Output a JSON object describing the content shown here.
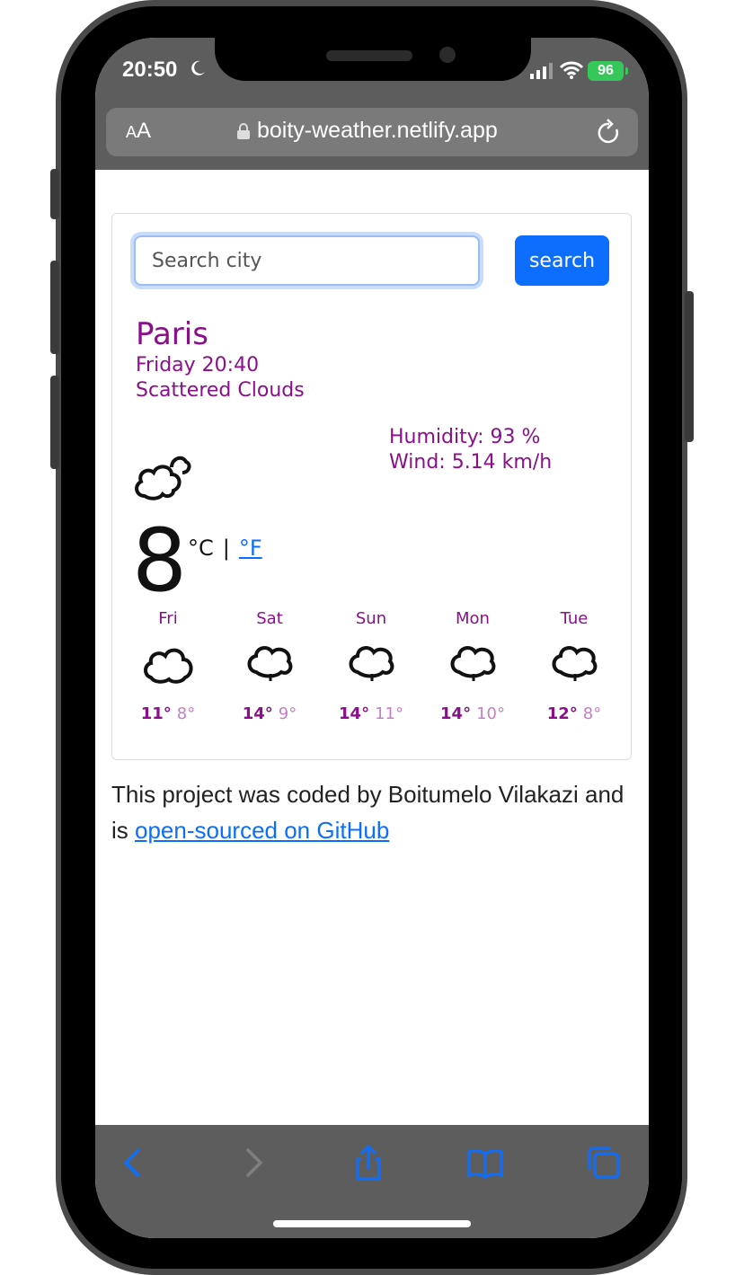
{
  "status_bar": {
    "time": "20:50",
    "battery": "96"
  },
  "browser": {
    "text_size_small": "A",
    "text_size_big": "A",
    "url": "boity-weather.netlify.app"
  },
  "search": {
    "placeholder": "Search city",
    "button_label": "search"
  },
  "weather": {
    "city": "Paris",
    "datetime": "Friday 20:40",
    "description": "Scattered Clouds",
    "humidity": "Humidity: 93 %",
    "wind": "Wind: 5.14 km/h",
    "temperature": "8",
    "unit_c": "°C",
    "unit_separator": "|",
    "unit_f": "°F",
    "icon": "scattered-clouds-icon"
  },
  "forecast": [
    {
      "day": "Fri",
      "max": "11°",
      "min": "8°",
      "icon": "cloud-icon"
    },
    {
      "day": "Sat",
      "max": "14°",
      "min": "9°",
      "icon": "cloud-icon"
    },
    {
      "day": "Sun",
      "max": "14°",
      "min": "11°",
      "icon": "cloud-icon"
    },
    {
      "day": "Mon",
      "max": "14°",
      "min": "10°",
      "icon": "cloud-icon"
    },
    {
      "day": "Tue",
      "max": "12°",
      "min": "8°",
      "icon": "cloud-icon"
    }
  ],
  "footer": {
    "text": "This project was coded by Boitumelo Vilakazi and is ",
    "link_text": "open-sourced on GitHub"
  },
  "colors": {
    "accent": "#0d6efd",
    "purple": "#8b0f8b"
  }
}
